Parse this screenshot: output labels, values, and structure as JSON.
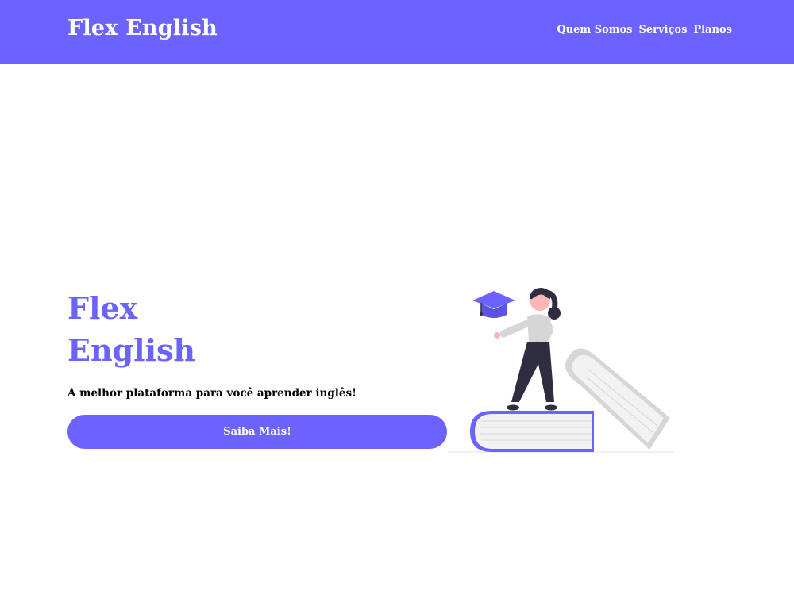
{
  "header": {
    "logo": "Flex English",
    "nav": [
      "Quem Somos",
      "Serviços",
      "Planos"
    ]
  },
  "hero": {
    "title_line1": "Flex",
    "title_line2": "English",
    "subtitle": "A melhor plataforma para você aprender inglês!",
    "cta_label": "Saiba Mais!"
  },
  "colors": {
    "brand": "#6c63ff",
    "text_dark": "#000000",
    "book_gray": "#d6d6d6",
    "figure_dark": "#2f2e41",
    "skin": "#ffb6b6"
  }
}
